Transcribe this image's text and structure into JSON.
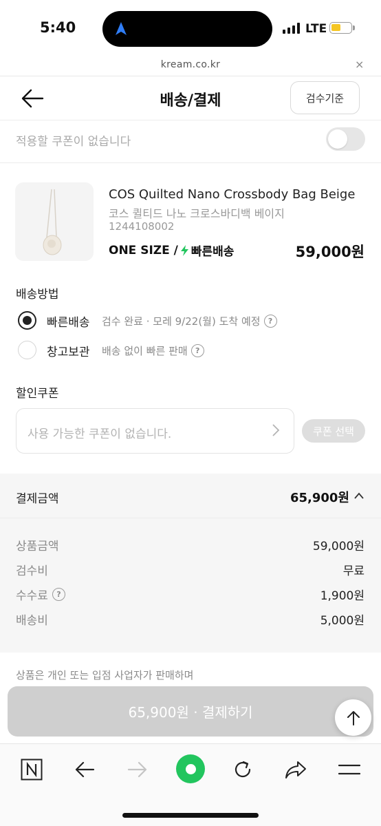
{
  "status_bar": {
    "time": "5:40",
    "network": "LTE"
  },
  "browser": {
    "url": "kream.co.kr",
    "close_glyph": "×"
  },
  "header": {
    "title": "배송/결제",
    "criteria_button": "검수기준"
  },
  "coupon_toggle": {
    "label": "적용할 쿠폰이 없습니다",
    "enabled": false
  },
  "product": {
    "name_en": "COS Quilted Nano Crossbody Bag Beige",
    "name_ko": "코스 퀼티드 나노 크로스바디백 베이지",
    "code": "1244108002",
    "size": "ONE SIZE /",
    "delivery_tag": "빠른배송",
    "price": "59,000원"
  },
  "shipping": {
    "title": "배송방법",
    "options": [
      {
        "label": "빠른배송",
        "sub": "검수 완료 · 모레 9/22(월) 도착 예정",
        "selected": true
      },
      {
        "label": "창고보관",
        "sub": "배송 없이 빠른 판매",
        "selected": false
      }
    ]
  },
  "discount": {
    "title": "할인쿠폰",
    "placeholder": "사용 가능한 쿠폰이 없습니다.",
    "select_button": "쿠폰 선택"
  },
  "payment": {
    "title": "결제금액",
    "total": "65,900원",
    "rows": [
      {
        "label": "상품금액",
        "value": "59,000원"
      },
      {
        "label": "검수비",
        "value": "무료"
      },
      {
        "label": "수수료",
        "value": "1,900원",
        "help": true
      },
      {
        "label": "배송비",
        "value": "5,000원"
      }
    ]
  },
  "notice": "상품은 개인 또는 입점 사업자가 판매하며",
  "pay_button": "65,900원 · 결제하기",
  "colors": {
    "accent_green": "#22c55e",
    "button_disabled": "#cfcfcf"
  },
  "icons": [
    "back-arrow-icon",
    "lightning-icon",
    "help-icon",
    "chevron-right-icon",
    "chevron-up-icon",
    "arrow-up-icon",
    "naver-n-icon",
    "refresh-icon",
    "share-icon",
    "menu-icon"
  ]
}
